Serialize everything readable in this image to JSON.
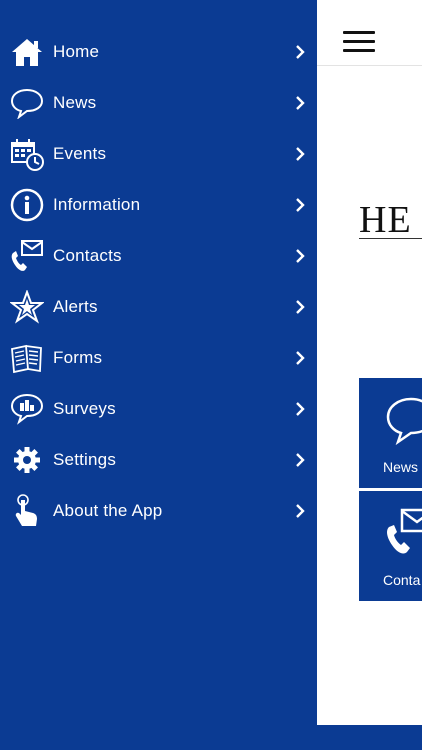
{
  "menu": {
    "items": [
      {
        "label": "Home",
        "icon": "home-icon"
      },
      {
        "label": "News",
        "icon": "speech-bubble-icon"
      },
      {
        "label": "Events",
        "icon": "calendar-clock-icon"
      },
      {
        "label": "Information",
        "icon": "info-icon"
      },
      {
        "label": "Contacts",
        "icon": "phone-mail-icon"
      },
      {
        "label": "Alerts",
        "icon": "star-icon"
      },
      {
        "label": "Forms",
        "icon": "forms-icon"
      },
      {
        "label": "Surveys",
        "icon": "chart-bubble-icon"
      },
      {
        "label": "Settings",
        "icon": "gear-icon"
      },
      {
        "label": "About the App",
        "icon": "tap-hand-icon"
      }
    ]
  },
  "main": {
    "hero_title": "HE",
    "tiles": [
      {
        "label": "News",
        "icon": "speech-bubble-icon"
      },
      {
        "label": "Conta",
        "icon": "phone-mail-icon"
      }
    ]
  },
  "colors": {
    "brand_blue": "#0b3b93",
    "content_bg": "#ffffff"
  }
}
